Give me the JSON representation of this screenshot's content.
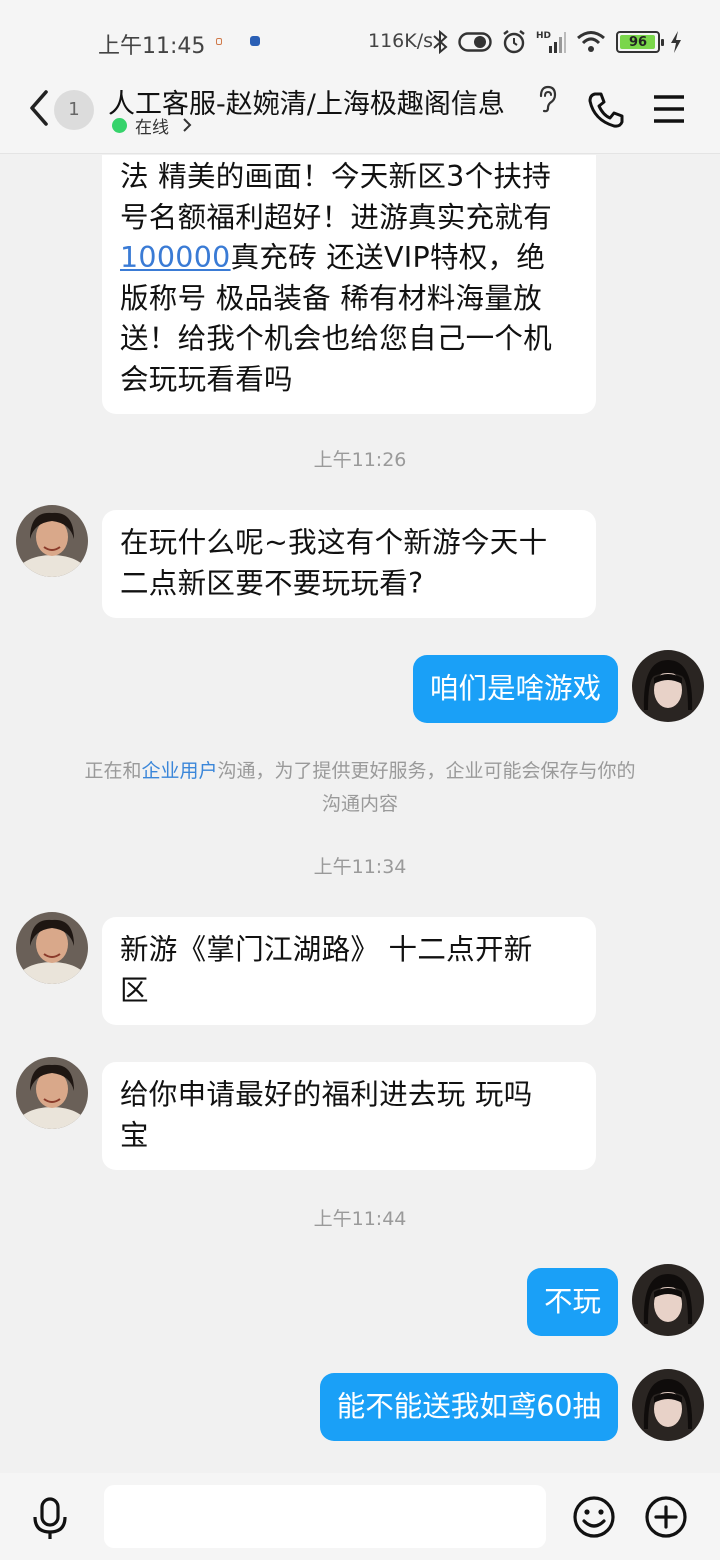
{
  "status_bar": {
    "time": "上午11:45",
    "net_speed": "116K/s",
    "battery": "96",
    "battery_level": 0.96,
    "icons": [
      "bluetooth-icon",
      "toggle-icon",
      "alarm-icon",
      "signal-icon",
      "wifi-icon",
      "battery-icon",
      "charging-icon"
    ]
  },
  "header": {
    "unread_count": "1",
    "title": "人工客服-赵婉清/上海极趣阁信息",
    "status": "在线",
    "icons": [
      "back-icon",
      "ear-icon",
      "phone-icon",
      "menu-icon"
    ]
  },
  "messages": {
    "m0": {
      "lines": [
        "法 精美的画面！今天新区3个扶持",
        "号名额福利超好！进游真实充就有",
        "真充砖 还送VIP特权，绝",
        "版称号 极品装备 稀有材料海量放",
        "送！给我个机会也给您自己一个机",
        "会玩玩看看吗"
      ],
      "link": "100000"
    },
    "ts1": "上午11:26",
    "m1": {
      "lines": [
        "在玩什么呢~我这有个新游今天十",
        "二点新区要不要玩玩看?"
      ]
    },
    "m2": "咱们是啥游戏",
    "notice": {
      "pre": "正在和",
      "highlight": "企业用户",
      "post": "沟通，为了提供更好服务，企业可能会保存与你的",
      "line2": "沟通内容"
    },
    "ts2": "上午11:34",
    "m3": {
      "lines": [
        "新游《掌门江湖路》 十二点开新",
        "区"
      ]
    },
    "m4": {
      "lines": [
        "给你申请最好的福利进去玩 玩吗",
        "宝"
      ]
    },
    "ts3": "上午11:44",
    "m5": "不玩",
    "m6": "能不能送我如鸢60抽"
  },
  "input_bar": {
    "placeholder": "",
    "icons": [
      "microphone-icon",
      "emoji-icon",
      "plus-icon"
    ]
  },
  "colors": {
    "outgoing_bubble": "#1aa0f7",
    "incoming_bubble": "#ffffff",
    "chat_background": "#f1f1f1",
    "online": "#36d36b",
    "link": "#3a7bd5"
  }
}
